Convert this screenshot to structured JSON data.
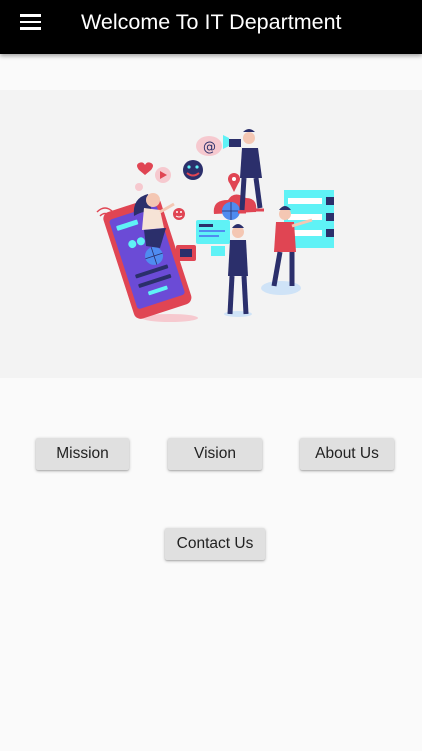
{
  "app_bar": {
    "title": "Welcome To IT Department",
    "menu_icon": "hamburger-menu-icon",
    "background": "#000000",
    "title_color": "#ffffff"
  },
  "banner": {
    "illustration": "digital-marketing-illustration"
  },
  "buttons": {
    "mission": "Mission",
    "vision": "Vision",
    "about": "About Us",
    "contact": "Contact Us"
  },
  "colors": {
    "page_background": "#fafafa",
    "banner_background": "#f3f3f3",
    "button_background": "#e0e0e0",
    "illustration_accent_red": "#e04553",
    "illustration_accent_navy": "#2b2f6b",
    "illustration_accent_cyan": "#5ff2f6"
  }
}
